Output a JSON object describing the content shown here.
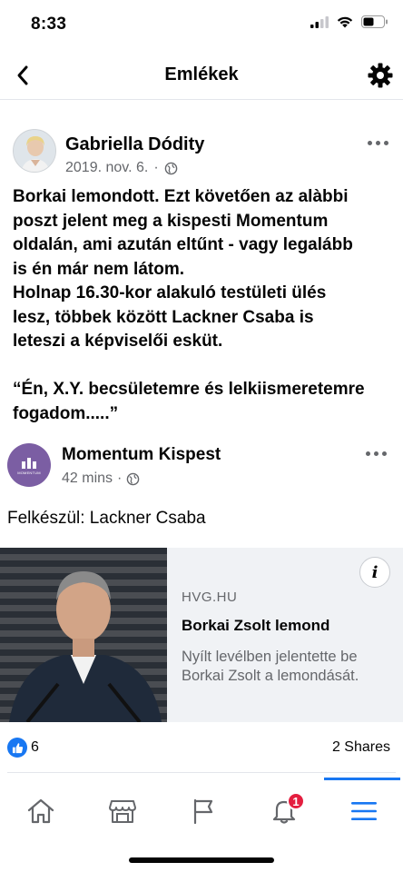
{
  "status_bar": {
    "time": "8:33"
  },
  "header": {
    "title": "Emlékek",
    "back_icon": "chevron-left-icon",
    "settings_icon": "gear-icon"
  },
  "post": {
    "author": "Gabriella Dódity",
    "date": "2019. nov. 6.",
    "separator": "·",
    "privacy_icon": "globe-icon",
    "text": "Borkai lemondott. Ezt követően az alàbbi\nposzt jelent meg a kispesti Momentum\noldalán, ami azután eltűnt - vagy legalább\nis én már nem látom.\nHolnap 16.30-kor alakuló testületi ülés\nlesz, többek között Lackner Csaba is\nleteszi a képviselői esküt.\n\n“Én, X.Y. becsületemre és lelkiismeretemre\nfogadom.....”"
  },
  "shared": {
    "page_name": "Momentum Kispest",
    "time": "42 mins",
    "separator": "·",
    "avatar_label": "MOMENTUM",
    "text": "Felkészül: Lackner Csaba",
    "link": {
      "domain": "HVG.HU",
      "title": "Borkai Zsolt lemond",
      "description": "Nyílt levélben jelentette be Borkai Zsolt a lemondását.",
      "info_label": "i"
    }
  },
  "reactions": {
    "likes": "6",
    "shares": "2 Shares"
  },
  "tab_bar": {
    "notifications_badge": "1",
    "active_tab": "menu"
  },
  "colors": {
    "accent": "#1877f2",
    "badge": "#e41e3f",
    "secondary_text": "#65676b",
    "momentum_purple": "#7b5ea3"
  }
}
